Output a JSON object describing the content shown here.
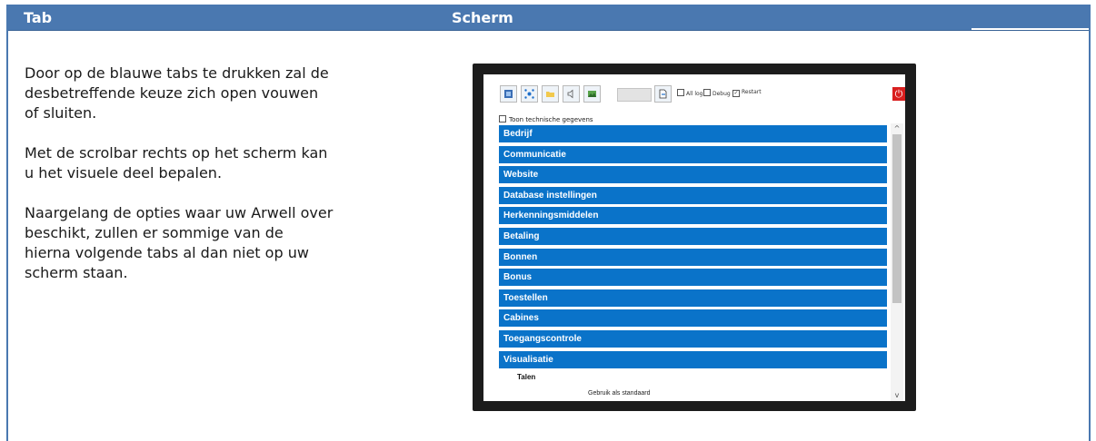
{
  "header": {
    "tab": "Tab",
    "screen": "Scherm"
  },
  "description": [
    "Door op de blauwe tabs te drukken zal de desbetreffende keuze zich open vouwen of sluiten.",
    "Met de scrolbar rechts op het scherm kan u het visuele deel bepalen.",
    "Naargelang de opties waar uw Arwell over beschikt, zullen er sommige van de hierna volgende tabs al dan niet op uw scherm staan."
  ],
  "screenshot": {
    "checkboxes": [
      {
        "label": "All log",
        "checked": false
      },
      {
        "label": "Debug",
        "checked": false
      },
      {
        "label": "Restart",
        "checked": true
      }
    ],
    "tech_toggle": "Toon technische gegevens",
    "tabs": [
      "Bedrijf",
      "Communicatie",
      "Website",
      "Database instellingen",
      "Herkenningsmiddelen",
      "Betaling",
      "Bonnen",
      "Bonus",
      "Toestellen",
      "Cabines",
      "Toegangscontrole",
      "Visualisatie"
    ],
    "sub_label": "Talen",
    "sub_item": "Gebruik als standaard",
    "power_icon": "⏻",
    "accent_color": "#0a73c9",
    "header_color": "#4a78b0"
  }
}
